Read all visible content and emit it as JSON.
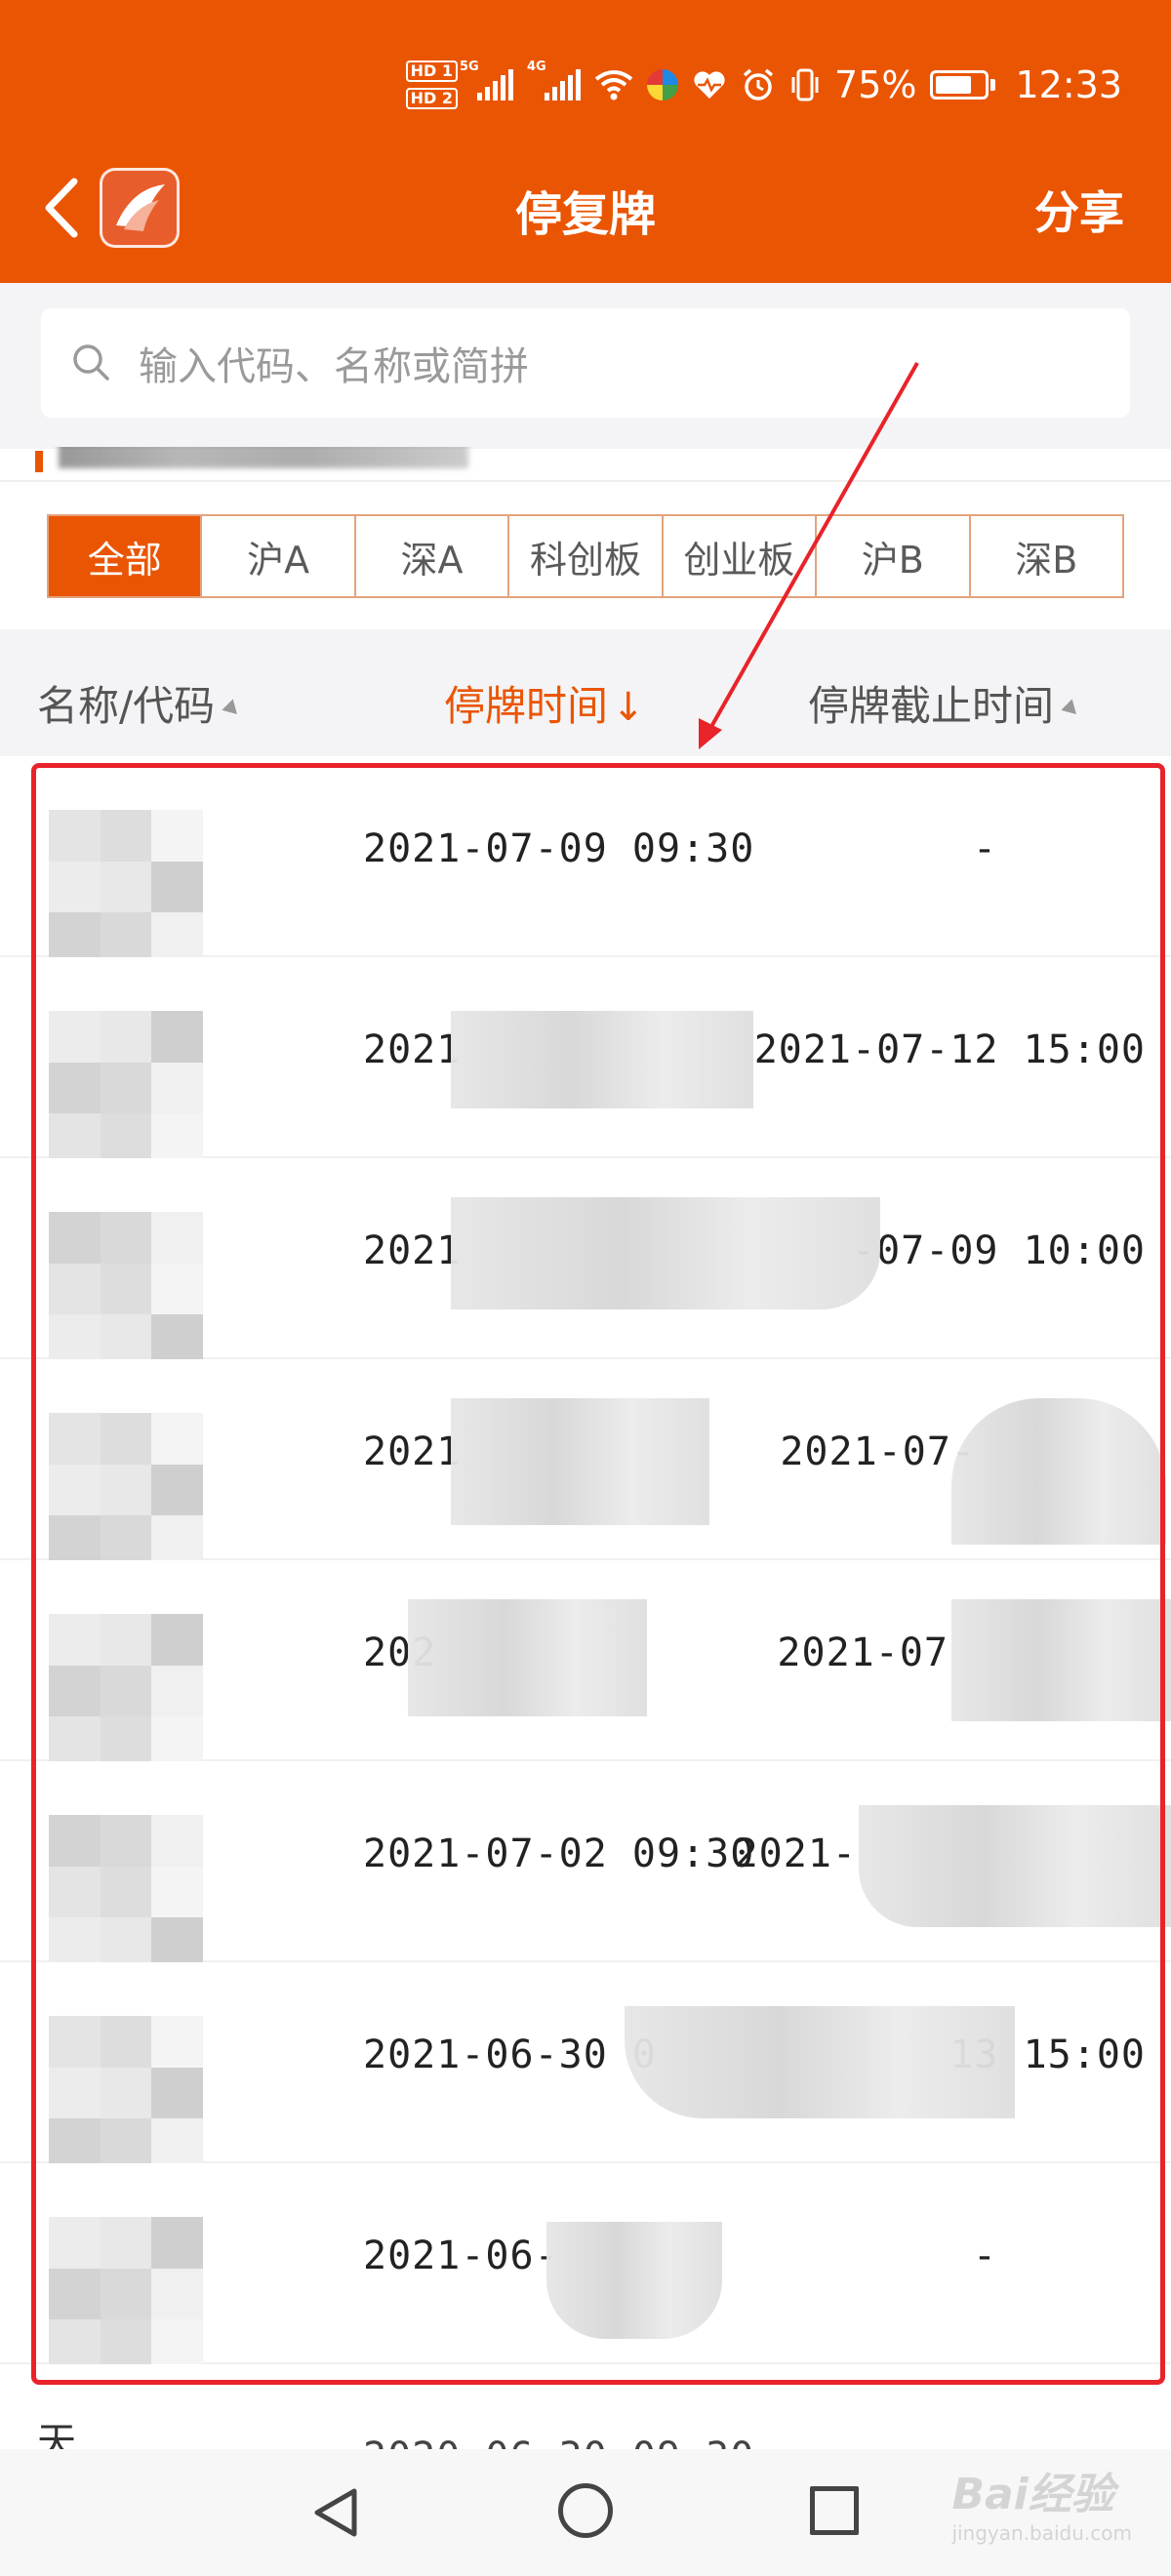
{
  "status_bar": {
    "hd1": "HD 1",
    "hd2": "HD 2",
    "net1": "5G",
    "net2": "4G",
    "wifi_label": "6",
    "battery_percent": "75%",
    "battery_level": 0.75,
    "time": "12:33"
  },
  "header": {
    "title": "停复牌",
    "share_label": "分享"
  },
  "search": {
    "placeholder": "输入代码、名称或简拼"
  },
  "market_tabs": [
    "全部",
    "沪A",
    "深A",
    "科创板",
    "创业板",
    "沪B",
    "深B"
  ],
  "active_tab": "全部",
  "columns": {
    "name": "名称/代码",
    "suspend_time": "停牌时间",
    "suspend_arrow": "↓",
    "end_time": "停牌截止时间"
  },
  "rows": [
    {
      "suspend_time": "2021-07-09 09:30",
      "end_time": "-"
    },
    {
      "suspend_time": "2021",
      "end_time": "2021-07-12 15:00"
    },
    {
      "suspend_time": "2021",
      "end_time": "-07-09 10:00"
    },
    {
      "suspend_time": "2021",
      "end_time": "2021-07-"
    },
    {
      "suspend_time": "202",
      "end_time": "2021-07"
    },
    {
      "suspend_time": "2021-07-02 09:30",
      "end_time": "2021-"
    },
    {
      "suspend_time": "2021-06-30 0",
      "end_time": "13 15:00"
    },
    {
      "suspend_time": "2021-06-",
      "end_time": "-"
    }
  ],
  "partial_row_name": "天",
  "watermark": {
    "brand": "Bai经验",
    "url": "jingyan.baidu.com"
  },
  "colors": {
    "accent": "#ea5504",
    "annotation_red": "#e8232a"
  }
}
